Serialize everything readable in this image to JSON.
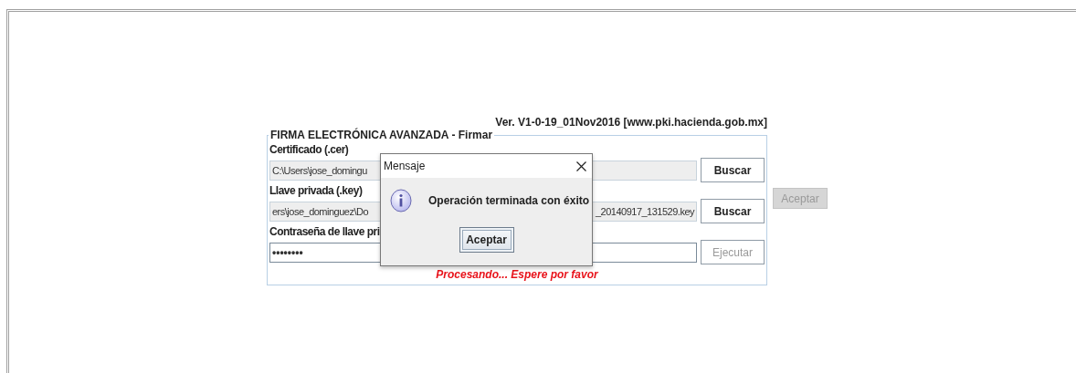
{
  "version": "Ver. V1-0-19_01Nov2016 [www.pki.hacienda.gob.mx]",
  "form": {
    "legend": "FIRMA ELECTRÓNICA AVANZADA - Firmar",
    "rows": [
      {
        "label": "Certificado (.cer)",
        "kind": "file",
        "value_start": "C:\\Users\\jose_domingu",
        "button": {
          "label": "Buscar",
          "disabled": false
        }
      },
      {
        "label": "Llave privada (.key)",
        "kind": "file",
        "value_start": "ers\\jose_dominguez\\Do",
        "value_end": "_20140917_131529.key",
        "button": {
          "label": "Buscar",
          "disabled": false
        }
      },
      {
        "label": "Contraseña de llave pri",
        "kind": "password",
        "value_start": "••••••••",
        "button": {
          "label": "Ejecutar",
          "disabled": true
        }
      }
    ],
    "status": "Procesando... Espere por favor"
  },
  "side_button": {
    "label": "Aceptar",
    "disabled": true
  },
  "dialog": {
    "title": "Mensaje",
    "message": "Operación terminada con éxito",
    "button": {
      "label": "Aceptar",
      "focused": true
    }
  }
}
